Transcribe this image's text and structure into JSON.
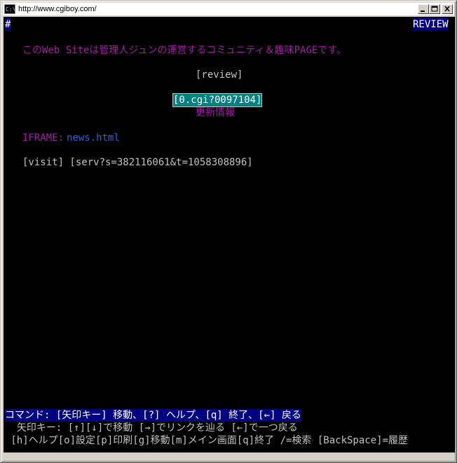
{
  "window": {
    "title": "http://www.cgiboy.com/",
    "icon_label": "C:\\",
    "buttons": [
      "minimize",
      "maximize",
      "close"
    ]
  },
  "header": {
    "hash": "#",
    "mode": "REVIEW"
  },
  "page": {
    "intro": "このWeb Siteは管理人ジュンの運営するコミュニティ＆趣味PAGEです。",
    "review_link": "[review]",
    "counter_link": "[0.cgi?0097104]",
    "update_link": "更新情報",
    "iframe_label": "IFRAME: ",
    "iframe_link": "news.html",
    "visit_line": "[visit] [serv?s=382116061&t=1058308896]"
  },
  "status": {
    "command_line": "コマンド: [矢印キー] 移動、[?] ヘルプ、[q] 終了、[←] 戻る",
    "arrow_help": "  矢印キー: [↑][↓]で移動 [→]でリンクを辿る [←]で一つ戻る",
    "key_help": " [h]ヘルプ[o]設定[p]印刷[g]移動[m]メイン画面[q]終了 /=検索 [BackSpace]=履歴"
  },
  "colors": {
    "background": "#000000",
    "text": "#c0c0c0",
    "purple": "#a020a0",
    "link_blue": "#3060d0",
    "highlight_navy": "#000080",
    "highlight_teal": "#008080"
  }
}
